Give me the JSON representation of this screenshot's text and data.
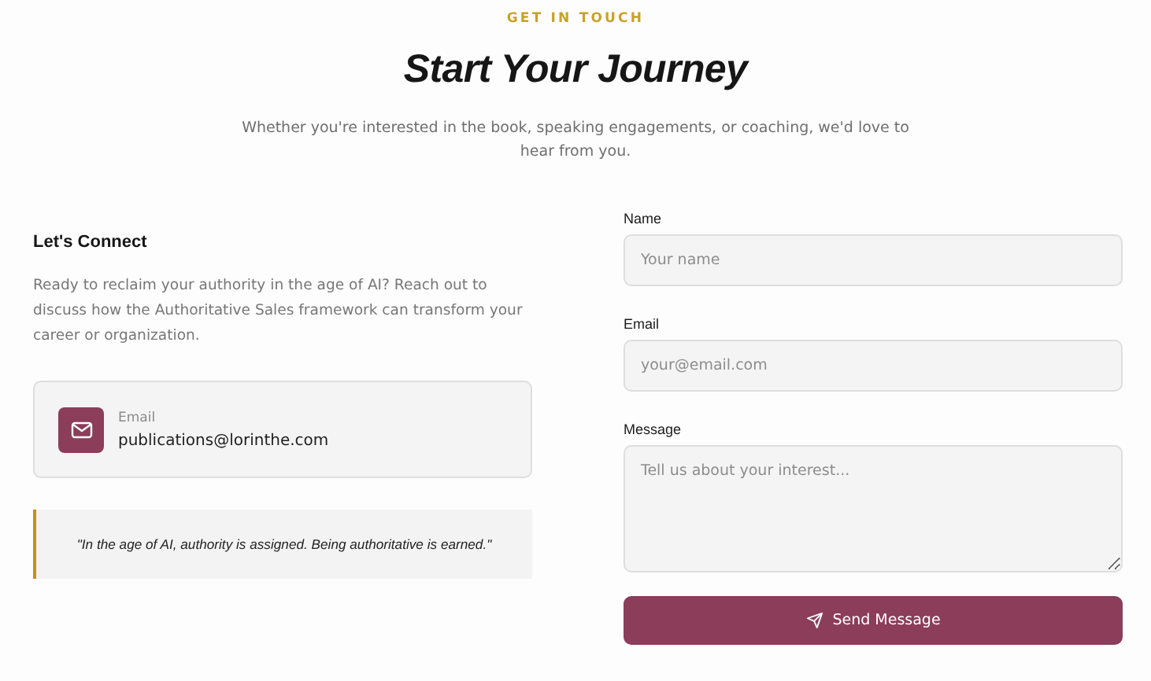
{
  "header": {
    "eyebrow": "GET IN TOUCH",
    "title": "Start Your Journey",
    "subtitle": "Whether you're interested in the book, speaking engagements, or coaching, we'd love to hear from you."
  },
  "connect": {
    "heading": "Let's Connect",
    "text": "Ready to reclaim your authority in the age of AI? Reach out to discuss how the Authoritative Sales framework can transform your career or organization.",
    "contact": {
      "label": "Email",
      "value": "publications@lorinthe.com"
    },
    "quote": "\"In the age of AI, authority is assigned. Being authoritative is earned.\""
  },
  "form": {
    "fields": [
      {
        "kind": "input",
        "label": "Name",
        "placeholder": "Your name"
      },
      {
        "kind": "input",
        "label": "Email",
        "placeholder": "your@email.com"
      },
      {
        "kind": "textarea",
        "label": "Message",
        "placeholder": "Tell us about your interest..."
      }
    ],
    "submit": "Send Message"
  }
}
